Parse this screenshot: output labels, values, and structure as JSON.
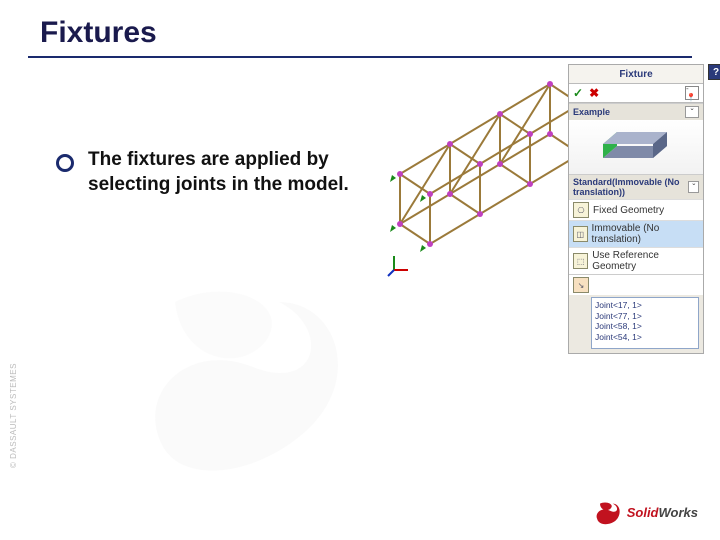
{
  "title": "Fixtures",
  "bullet": "The fixtures are applied by selecting joints in the model.",
  "panel": {
    "title": "Fixture",
    "help": "?",
    "ok": "✓",
    "cancel": "✖",
    "pin_icon": "📌",
    "sections": {
      "example": {
        "label": "Example",
        "chev": "ˇ"
      },
      "standard": {
        "label": "Standard(Immovable (No translation))",
        "chev": "ˇ"
      }
    },
    "type_rows": [
      {
        "icon": "⎔",
        "label": "Fixed Geometry"
      },
      {
        "icon": "◫",
        "label": "Immovable (No translation)"
      },
      {
        "icon": "⬚",
        "label": "Use Reference Geometry"
      }
    ],
    "selection_icon": "↘",
    "joints": [
      "Joint<17, 1>",
      "Joint<77, 1>",
      "Joint<58, 1>",
      "Joint<54, 1>"
    ]
  },
  "copyright": "© DASSAULT SYSTEMES",
  "logo": {
    "solid": "Solid",
    "works": "Works"
  }
}
